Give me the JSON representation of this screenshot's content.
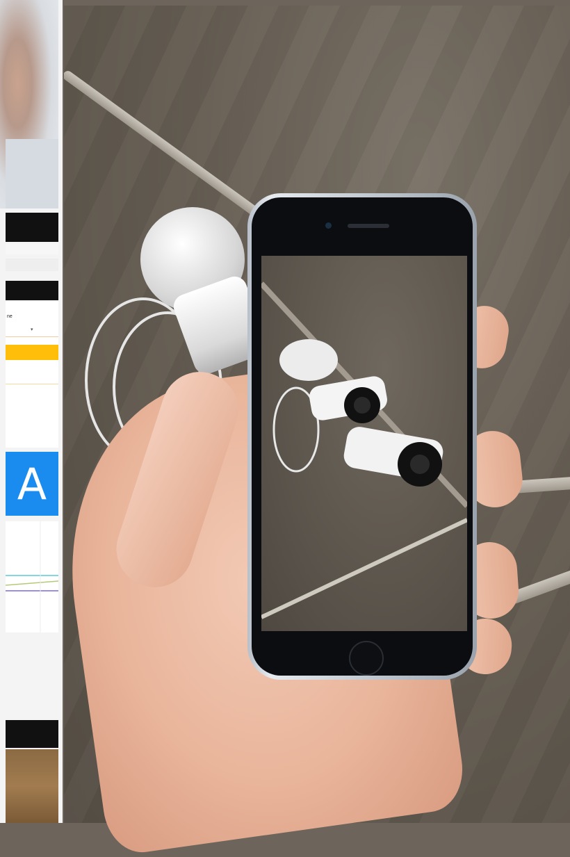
{
  "left_panel": {
    "tile_letter": "A",
    "tiny_label": "ne",
    "tiny_caret": "▾",
    "colors": {
      "orange": "#ffbe0a",
      "tile_blue": "#1a8cf0"
    }
  },
  "photo": {
    "subject": "hand-holding-phone-with-ar-security-cameras"
  }
}
